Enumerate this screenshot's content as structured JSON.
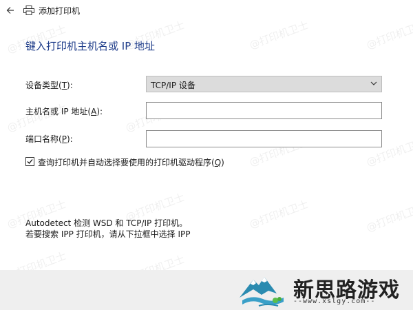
{
  "window": {
    "title": "添加打印机"
  },
  "heading": "键入打印机主机名或 IP 地址",
  "form": {
    "device_type": {
      "label_text": "设备类型(",
      "label_key": "T",
      "label_suffix": "):",
      "value": "TCP/IP 设备"
    },
    "host": {
      "label_text": "主机名或 IP 地址(",
      "label_key": "A",
      "label_suffix": "):",
      "value": ""
    },
    "port": {
      "label_text": "端口名称(",
      "label_key": "P",
      "label_suffix": "):",
      "value": ""
    },
    "query_checkbox": {
      "label_text": "查询打印机并自动选择要使用的打印机驱动程序(",
      "label_key": "Q",
      "label_suffix": ")",
      "checked": true
    }
  },
  "info": {
    "line1": "Autodetect 检测 WSD 和 TCP/IP 打印机。",
    "line2": "若要搜索 IPP 打印机，请从下拉框中选择 IPP"
  },
  "watermark": "@打印机卫士",
  "logo": {
    "name": "新思路游戏",
    "url": "--www.xslgy.com--"
  }
}
